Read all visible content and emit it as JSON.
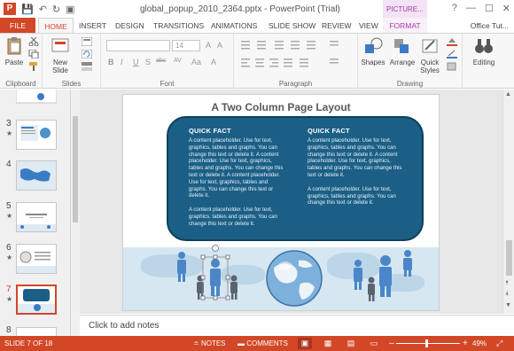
{
  "window": {
    "title": "global_popup_2010_2364.pptx - PowerPoint (Trial)",
    "contextual_tab_group": "PICTURE...",
    "controls": [
      "?",
      "—",
      "☐",
      "✕"
    ],
    "app_icon_letter": "P"
  },
  "qat": {
    "save": "💾",
    "undo": "↶",
    "redo": "↻",
    "present": "▣"
  },
  "tabs": [
    {
      "label": "FILE"
    },
    {
      "label": "HOME"
    },
    {
      "label": "INSERT"
    },
    {
      "label": "DESIGN"
    },
    {
      "label": "TRANSITIONS"
    },
    {
      "label": "ANIMATIONS"
    },
    {
      "label": "SLIDE SHOW"
    },
    {
      "label": "REVIEW"
    },
    {
      "label": "VIEW"
    },
    {
      "label": "FORMAT"
    }
  ],
  "user": "Office Tut...",
  "ribbon": {
    "groups": {
      "clipboard": "Clipboard",
      "slides": "Slides",
      "font": "Font",
      "paragraph": "Paragraph",
      "drawing": "Drawing",
      "editing": ""
    },
    "paste": "Paste",
    "new_slide_line1": "New",
    "new_slide_line2": "Slide",
    "font_size": "14",
    "shapes": "Shapes",
    "arrange": "Arrange",
    "quick_styles_line1": "Quick",
    "quick_styles_line2": "Styles",
    "editing": "Editing",
    "fmt": [
      "B",
      "I",
      "U",
      "S",
      "abc",
      "AV",
      "Aa",
      "A"
    ]
  },
  "thumbnails": [
    {
      "num": "3",
      "star": "★",
      "active": false
    },
    {
      "num": "4",
      "star": "",
      "active": false
    },
    {
      "num": "5",
      "star": "★",
      "active": false
    },
    {
      "num": "6",
      "star": "★",
      "active": false
    },
    {
      "num": "7",
      "star": "★",
      "active": true
    },
    {
      "num": "8",
      "star": "",
      "active": false
    }
  ],
  "slide": {
    "title": "A Two Column Page Layout",
    "left": {
      "heading": "QUICK FACT",
      "para1": "A content placeholder.  Use for text, graphics, tables and graphs.  You can change this text or delete it. A content placeholder.  Use for text, graphics, tables and graphs.  You can change this text or delete it. A content placeholder.  Use for text, graphics, tables and graphs.  You can change this text or delete it.",
      "para2": "A content placeholder.  Use for text, graphics, tables and graphs.  You can change this text or delete it."
    },
    "right": {
      "heading": "QUICK FACT",
      "para1": "A content placeholder.  Use for text, graphics, tables and graphs.  You can change this text or delete it. A content placeholder.  Use for text, graphics, tables and graphs.  You can change this text or delete it.",
      "para2": "A content placeholder.  Use for text, graphics, tables and graphs.  You can change this text or delete it."
    }
  },
  "notes_placeholder": "Click to add notes",
  "status": {
    "slide": "SLIDE 7 OF 18",
    "notes": "NOTES",
    "comments": "COMMENTS",
    "zoom": "49%",
    "zoom_minus": "–",
    "zoom_plus": "+"
  },
  "colors": {
    "accent": "#d24726",
    "callout": "#1b5f86",
    "picture_tools": "#a33ca6",
    "people_blue": "#3a7cc4"
  }
}
